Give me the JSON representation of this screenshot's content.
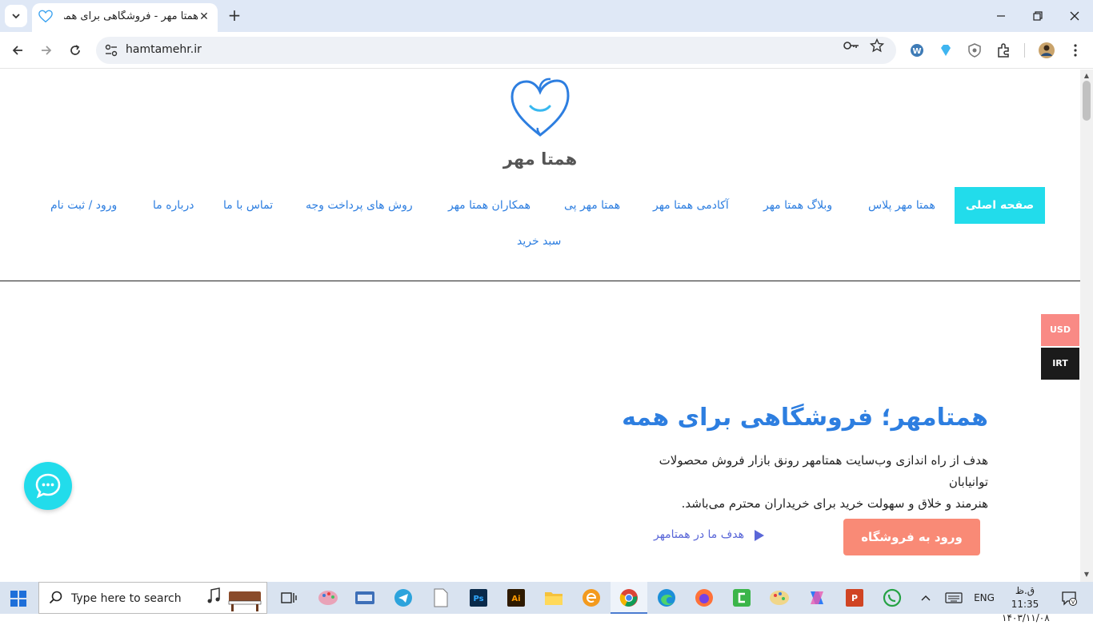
{
  "browser": {
    "tab_title": "همتا مهر - فروشگاهی برای همه",
    "url": "hamtamehr.ir",
    "tab_close": "✕",
    "new_tab": "+"
  },
  "page": {
    "brand_name": "همتا مهر",
    "menu": {
      "active": "صفحه اصلی",
      "items": [
        "همتا مهر پلاس",
        "وبلاگ همتا مهر",
        "آکادمی همتا مهر",
        "همتا مهر پی",
        "همکاران همتا مهر",
        "روش های پرداخت وجه",
        "تماس با ما",
        "درباره ما",
        "ورود / ثبت نام"
      ],
      "second_row": "سبد خرید"
    },
    "hero": {
      "title": "همتامهر؛ فروشگاهی برای همه",
      "text_line1": "هدف از راه اندازی وب‌سایت همتامهر رونق بازار فروش محصولات توانیابان",
      "text_line2": "هنرمند و خلاق و سهولت خرید برای خریداران محترم می‌باشد.",
      "cta": "ورود به فروشگاه",
      "video_link": "هدف ما در همتامهر"
    },
    "currency": {
      "usd": "USD",
      "irt": "IRT"
    }
  },
  "taskbar": {
    "search_placeholder": "Type here to search",
    "lang": "ENG",
    "time": "ق.ظ 11:35",
    "date": "۱۴۰۳/۱۱/۰۸"
  },
  "colors": {
    "accent_cyan": "#22dceb",
    "link_blue": "#2d7ee0",
    "cta_salmon": "#f98a76"
  }
}
